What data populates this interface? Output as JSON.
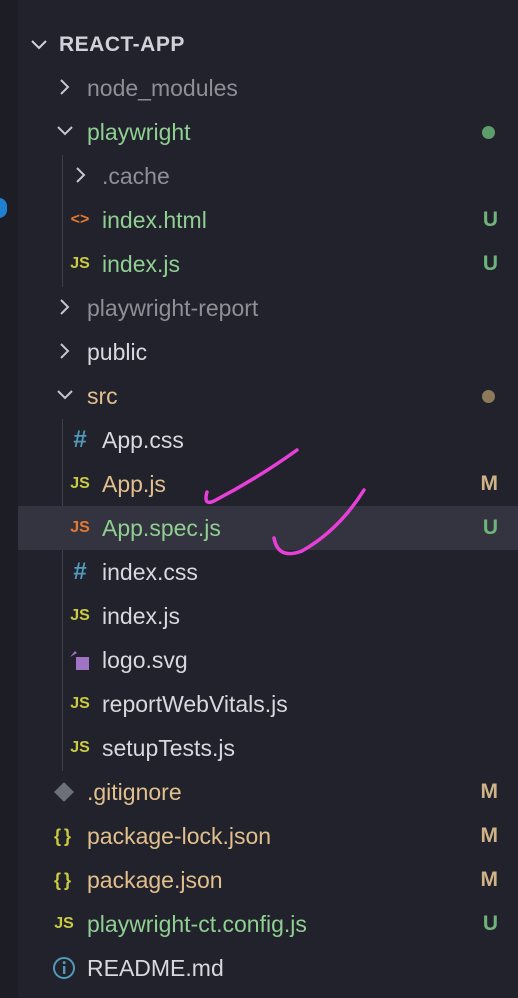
{
  "explorer": {
    "section_title": "REACT-APP",
    "items": [
      {
        "label": "node_modules",
        "kind": "folder",
        "open": false,
        "color": "#8d9096"
      },
      {
        "label": "playwright",
        "kind": "folder",
        "open": true,
        "color": "#8fcf92",
        "dot_color": "#5e9c6a"
      },
      {
        "label": ".cache",
        "kind": "folder",
        "open": false,
        "color": "#8d9096"
      },
      {
        "label": "index.html",
        "kind": "html",
        "icon_text": "<>",
        "color": "#8fcf92",
        "badge": "U",
        "badge_color": "#6fb37a"
      },
      {
        "label": "index.js",
        "kind": "js",
        "icon_text": "JS",
        "color": "#8fcf92",
        "badge": "U",
        "badge_color": "#6fb37a"
      },
      {
        "label": "playwright-report",
        "kind": "folder",
        "open": false,
        "color": "#8d9096"
      },
      {
        "label": "public",
        "kind": "folder",
        "open": false,
        "color": "#d7d9de"
      },
      {
        "label": "src",
        "kind": "folder",
        "open": true,
        "color": "#e2c08d",
        "dot_color": "#8d7a5a"
      },
      {
        "label": "App.css",
        "kind": "css",
        "icon_text": "#",
        "color": "#d7d9de"
      },
      {
        "label": "App.js",
        "kind": "js",
        "icon_text": "JS",
        "color": "#e2c08d",
        "badge": "M",
        "badge_color": "#d0b287"
      },
      {
        "label": "App.spec.js",
        "kind": "js",
        "icon_text": "JS",
        "color": "#8fcf92",
        "badge": "U",
        "badge_color": "#6fb37a",
        "selected": true
      },
      {
        "label": "index.css",
        "kind": "css",
        "icon_text": "#",
        "color": "#d7d9de"
      },
      {
        "label": "index.js",
        "kind": "js",
        "icon_text": "JS",
        "color": "#d7d9de"
      },
      {
        "label": "logo.svg",
        "kind": "svg",
        "color": "#d7d9de"
      },
      {
        "label": "reportWebVitals.js",
        "kind": "js",
        "icon_text": "JS",
        "color": "#d7d9de"
      },
      {
        "label": "setupTests.js",
        "kind": "js",
        "icon_text": "JS",
        "color": "#d7d9de"
      },
      {
        "label": ".gitignore",
        "kind": "git",
        "color": "#e2c08d",
        "badge": "M",
        "badge_color": "#d0b287"
      },
      {
        "label": "package-lock.json",
        "kind": "json",
        "icon_text": "{}",
        "color": "#e2c08d",
        "badge": "M",
        "badge_color": "#d0b287"
      },
      {
        "label": "package.json",
        "kind": "json",
        "icon_text": "{}",
        "color": "#e2c08d",
        "badge": "M",
        "badge_color": "#d0b287"
      },
      {
        "label": "playwright-ct.config.js",
        "kind": "js",
        "icon_text": "JS",
        "color": "#8fcf92",
        "badge": "U",
        "badge_color": "#6fb37a"
      },
      {
        "label": "README.md",
        "kind": "info",
        "color": "#d7d9de"
      }
    ]
  },
  "icon_colors": {
    "js": "#cbcb41",
    "js_selected": "#e37933",
    "html": "#e37933",
    "css": "#519aba",
    "json": "#cbcb41",
    "svg": "#a074c4",
    "git": "#6d7079",
    "info": "#519aba"
  },
  "annotation_color": "#e83fd8"
}
